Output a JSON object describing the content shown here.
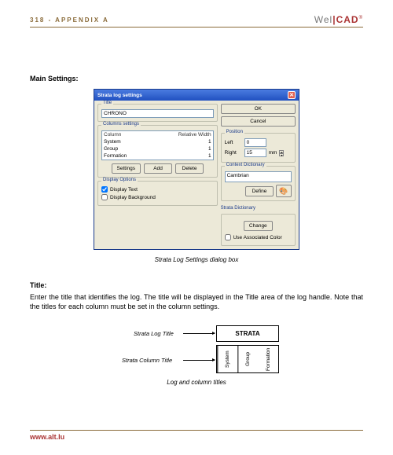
{
  "header": {
    "left": "318 - APPENDIX A",
    "brand_well": "Wel",
    "brand_cad": "CAD"
  },
  "section_heading": "Main Settings:",
  "dialog": {
    "title": "Strata log settings",
    "title_group": "Title",
    "title_value": "CHRONO",
    "columns_group": "Columns settings",
    "col_head_col": "Column",
    "col_head_width": "Relative Width",
    "rows": [
      {
        "name": "System",
        "width": "1"
      },
      {
        "name": "Group",
        "width": "1"
      },
      {
        "name": "Formation",
        "width": "1"
      }
    ],
    "btn_settings": "Settings",
    "btn_add": "Add",
    "btn_delete": "Delete",
    "display_group": "Display Options",
    "display_text": "Display Text",
    "display_bg": "Display Background",
    "position_group": "Position",
    "pos_left_label": "Left",
    "pos_left_value": "0",
    "pos_right_label": "Right",
    "pos_right_value": "15",
    "pos_unit": "mm",
    "ctx_group": "Context Dictionary",
    "ctx_value": "Cambrian",
    "btn_define": "Define",
    "strata_dict_link": "Strata Dictionary",
    "btn_change": "Change",
    "use_assoc": "Use Associated Color",
    "btn_ok": "OK",
    "btn_cancel": "Cancel"
  },
  "caption1": "Strata Log Settings dialog box",
  "para_title": "Title:",
  "para_body": "Enter the title that identifies the log. The title will be displayed in the Title area of the log handle. Note that the titles for each column must be set in the column settings.",
  "diagram": {
    "label_log_title": "Strata Log Title",
    "label_col_title": "Strata Column Title",
    "box_title": "STRATA",
    "cols": [
      "System",
      "Group",
      "Formation"
    ]
  },
  "caption2": "Log and column titles",
  "footer": "www.alt.lu"
}
